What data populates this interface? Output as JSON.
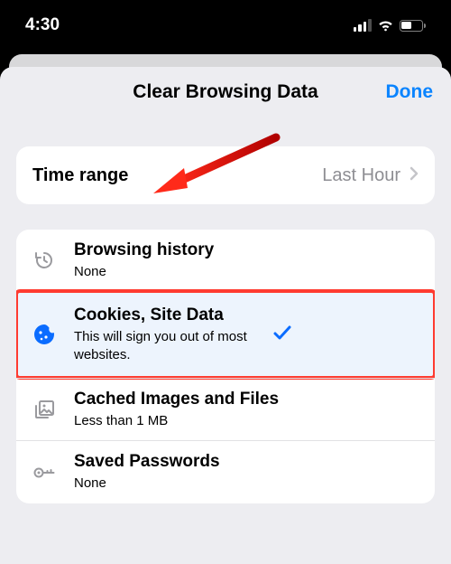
{
  "status": {
    "time": "4:30"
  },
  "header": {
    "title": "Clear Browsing Data",
    "done": "Done"
  },
  "timeRange": {
    "label": "Time range",
    "value": "Last Hour"
  },
  "items": [
    {
      "title": "Browsing history",
      "sub": "None"
    },
    {
      "title": "Cookies, Site Data",
      "sub": "This will sign you out of most websites."
    },
    {
      "title": "Cached Images and Files",
      "sub": "Less than 1 MB"
    },
    {
      "title": "Saved Passwords",
      "sub": "None"
    }
  ]
}
